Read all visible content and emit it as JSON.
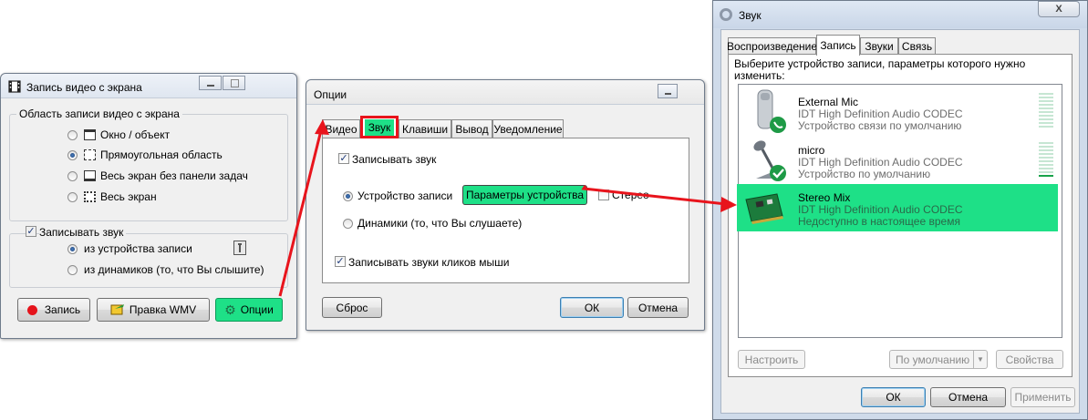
{
  "win1": {
    "title": "Запись видео с экрана",
    "area_group": "Область записи видео с экрана",
    "options": [
      "Окно / объект",
      "Прямоугольная область",
      "Весь экран без панели задач",
      "Весь экран"
    ],
    "sound_group": "Записывать звук",
    "sound_options": [
      "из устройства записи",
      "из динамиков (то, что Вы слышите)"
    ],
    "btn_record": "Запись",
    "btn_wmv": "Правка WMV",
    "btn_options": "Опции"
  },
  "win2": {
    "title": "Опции",
    "tabs": [
      "Видео",
      "Звук",
      "Клавиши",
      "Вывод",
      "Уведомление"
    ],
    "record_sound": "Записывать звук",
    "device_radio": "Устройство записи",
    "device_params": "Параметры устройства",
    "stereo": "Стерео",
    "speakers_radio": "Динамики (то, что Вы слушаете)",
    "mouse_clicks": "Записывать звуки кликов мыши",
    "btn_reset": "Сброс",
    "btn_ok": "ОК",
    "btn_cancel": "Отмена"
  },
  "win3": {
    "title": "Звук",
    "close": "X",
    "tabs": [
      "Воспроизведение",
      "Запись",
      "Звуки",
      "Связь"
    ],
    "instruction": "Выберите устройство записи, параметры которого нужно изменить:",
    "devices": [
      {
        "name": "External Mic",
        "driver": "IDT High Definition Audio CODEC",
        "status": "Устройство связи по умолчанию",
        "level": 0
      },
      {
        "name": "micro",
        "driver": "IDT High Definition Audio CODEC",
        "status": "Устройство по умолчанию",
        "level": 0.1
      },
      {
        "name": "Stereo Mix",
        "driver": "IDT High Definition Audio CODEC",
        "status": "Недоступно в настоящее время",
        "level": 0
      }
    ],
    "btn_configure": "Настроить",
    "btn_default": "По умолчанию",
    "btn_properties": "Свойства",
    "btn_ok": "ОК",
    "btn_cancel": "Отмена",
    "btn_apply": "Применить"
  },
  "colors": {
    "highlight": "#1ee087",
    "arrow": "#e8141c"
  }
}
